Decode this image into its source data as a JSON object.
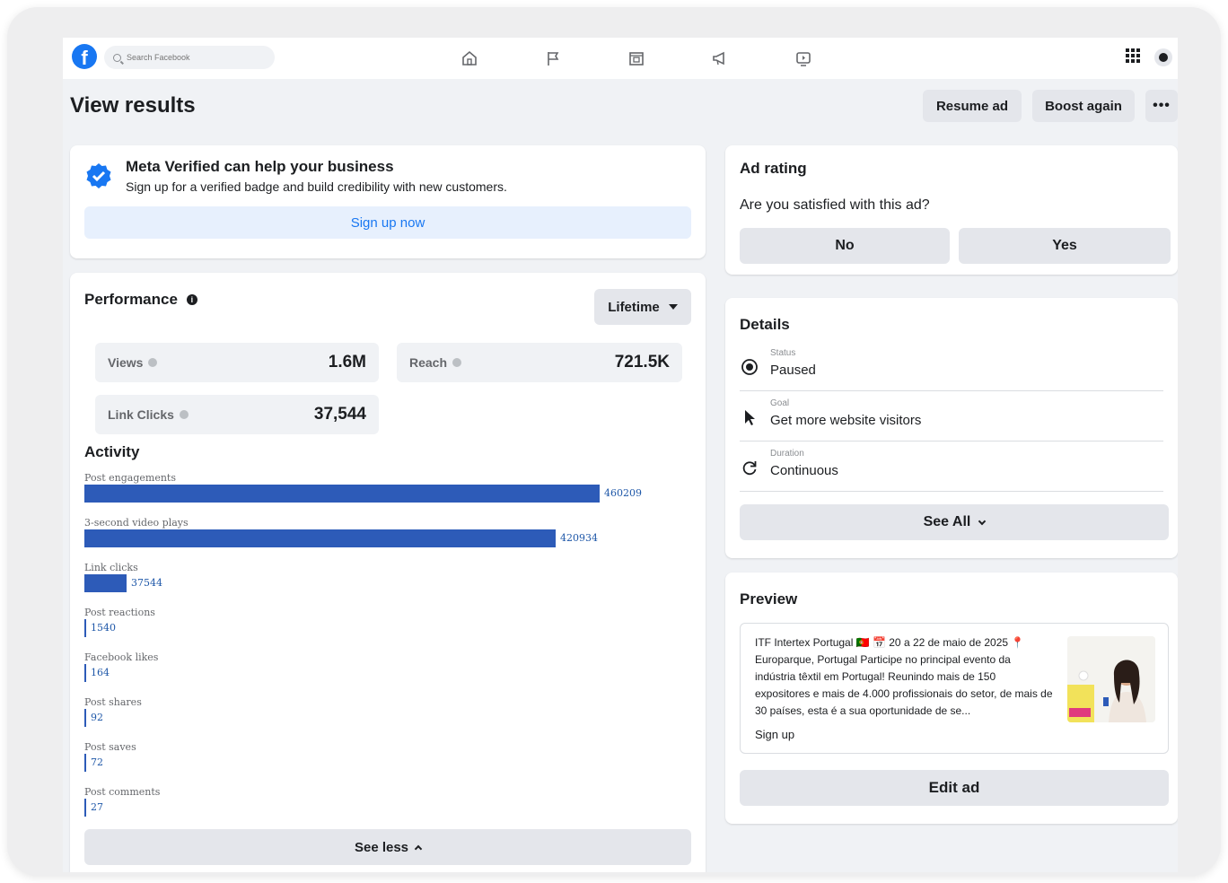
{
  "nav": {
    "search_placeholder": "Search Facebook",
    "icons": [
      "home-icon",
      "flag-icon",
      "marketplace-icon",
      "megaphone-icon",
      "video-icon",
      "menu-grid-icon"
    ]
  },
  "header": {
    "title": "View results",
    "resume_label": "Resume ad",
    "boost_label": "Boost again",
    "more_label": "•••"
  },
  "meta_verified": {
    "title": "Meta Verified can help your business",
    "subtitle": "Sign up for a verified badge and build credibility with new customers.",
    "button_label": "Sign up now"
  },
  "performance": {
    "title": "Performance",
    "range_label": "Lifetime",
    "metrics": [
      {
        "label": "Views",
        "value": "1.6M"
      },
      {
        "label": "Reach",
        "value": "721.5K"
      },
      {
        "label": "Link Clicks",
        "value": "37,544"
      }
    ]
  },
  "activity": {
    "title": "Activity",
    "max_value": 460209,
    "items": [
      {
        "label": "Post engagements",
        "value": "460209",
        "amount": 460209
      },
      {
        "label": "3-second video plays",
        "value": "420934",
        "amount": 420934
      },
      {
        "label": "Link clicks",
        "value": "37544",
        "amount": 37544
      },
      {
        "label": "Post reactions",
        "value": "1540",
        "amount": 1540
      },
      {
        "label": "Facebook likes",
        "value": "164",
        "amount": 164
      },
      {
        "label": "Post shares",
        "value": "92",
        "amount": 92
      },
      {
        "label": "Post saves",
        "value": "72",
        "amount": 72
      },
      {
        "label": "Post comments",
        "value": "27",
        "amount": 27
      }
    ],
    "see_less_label": "See less"
  },
  "ad_rating": {
    "title": "Ad rating",
    "question": "Are you satisfied with this ad?",
    "no_label": "No",
    "yes_label": "Yes"
  },
  "details": {
    "title": "Details",
    "rows": [
      {
        "label": "Status",
        "value": "Paused",
        "icon": "radio-icon"
      },
      {
        "label": "Goal",
        "value": "Get more website visitors",
        "icon": "cursor-icon"
      },
      {
        "label": "Duration",
        "value": "Continuous",
        "icon": "refresh-icon"
      }
    ],
    "see_all_label": "See All"
  },
  "preview": {
    "title": "Preview",
    "text": "ITF Intertex Portugal 🇵🇹 📅 20 a 22 de maio de 2025 📍 Europarque, Portugal Participe no principal evento da indústria têxtil em Portugal! Reunindo mais de 150 expositores e mais de 4.000 profissionais do setor, de mais de 30 países, esta é a sua oportunidade de se...",
    "cta": "Sign up",
    "edit_label": "Edit ad"
  },
  "colors": {
    "brand": "#1877f2",
    "bar": "#2d5bb8",
    "button_bg": "#e4e6eb"
  }
}
